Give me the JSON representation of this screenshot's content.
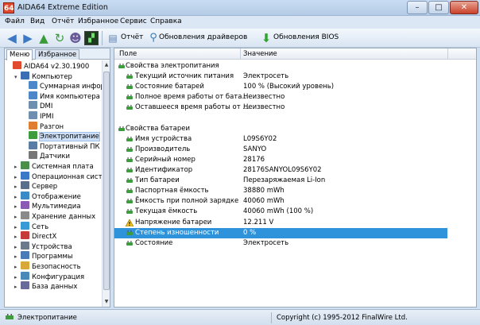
{
  "window": {
    "title": "AIDA64 Extreme Edition",
    "app_icon_text": "64",
    "min": "–",
    "max": "□",
    "close": "✕"
  },
  "menu": [
    "Файл",
    "Вид",
    "Отчёт",
    "Избранное",
    "Сервис",
    "Справка"
  ],
  "toolbar": {
    "report": "Отчёт",
    "driver_updates": "Обновления драйверов",
    "bios_updates": "Обновления BIOS"
  },
  "left": {
    "tabs": [
      "Меню",
      "Избранное"
    ],
    "tree": [
      {
        "label": "AIDA64 v2.30.1900",
        "level": 0,
        "exp": "",
        "icon": "#e04a2f"
      },
      {
        "label": "Компьютер",
        "level": 1,
        "exp": "▾",
        "icon": "#3a6fb5"
      },
      {
        "label": "Суммарная инфор",
        "level": 2,
        "exp": "",
        "icon": "#4b87c9"
      },
      {
        "label": "Имя компьютера",
        "level": 2,
        "exp": "",
        "icon": "#4b87c9"
      },
      {
        "label": "DMI",
        "level": 2,
        "exp": "",
        "icon": "#6f8fb0"
      },
      {
        "label": "IPMI",
        "level": 2,
        "exp": "",
        "icon": "#6f8fb0"
      },
      {
        "label": "Разгон",
        "level": 2,
        "exp": "",
        "icon": "#e07d2f"
      },
      {
        "label": "Электропитание",
        "level": 2,
        "exp": "",
        "icon": "#3e9b3e"
      },
      {
        "label": "Портативный ПК",
        "level": 2,
        "exp": "",
        "icon": "#5a7da6"
      },
      {
        "label": "Датчики",
        "level": 2,
        "exp": "",
        "icon": "#777777"
      },
      {
        "label": "Системная плата",
        "level": 1,
        "exp": "▸",
        "icon": "#4a8f4a"
      },
      {
        "label": "Операционная систем",
        "level": 1,
        "exp": "▸",
        "icon": "#3a78c8"
      },
      {
        "label": "Сервер",
        "level": 1,
        "exp": "▸",
        "icon": "#5a6f8a"
      },
      {
        "label": "Отображение",
        "level": 1,
        "exp": "▸",
        "icon": "#3a8ac8"
      },
      {
        "label": "Мультимедиа",
        "level": 1,
        "exp": "▸",
        "icon": "#8a5ab5"
      },
      {
        "label": "Хранение данных",
        "level": 1,
        "exp": "▸",
        "icon": "#8a8a8a"
      },
      {
        "label": "Сеть",
        "level": 1,
        "exp": "▸",
        "icon": "#3a9ad8"
      },
      {
        "label": "DirectX",
        "level": 1,
        "exp": "▸",
        "icon": "#c83a3a"
      },
      {
        "label": "Устройства",
        "level": 1,
        "exp": "▸",
        "icon": "#6a7a8a"
      },
      {
        "label": "Программы",
        "level": 1,
        "exp": "▸",
        "icon": "#4a7ab8"
      },
      {
        "label": "Безопасность",
        "level": 1,
        "exp": "▸",
        "icon": "#d8a83a"
      },
      {
        "label": "Конфигурация",
        "level": 1,
        "exp": "▸",
        "icon": "#4a8ab8"
      },
      {
        "label": "База данных",
        "level": 1,
        "exp": "▸",
        "icon": "#6a6a9a"
      }
    ],
    "selected_index": 7
  },
  "right": {
    "col_field": "Поле",
    "col_value": "Значение",
    "rows": [
      {
        "type": "section",
        "field": "Свойства электропитания",
        "value": ""
      },
      {
        "type": "item",
        "field": "Текущий источник питания",
        "value": "Электросеть"
      },
      {
        "type": "item",
        "field": "Состояние батарей",
        "value": "100 % (Высокий уровень)"
      },
      {
        "type": "item",
        "field": "Полное время работы от бата...",
        "value": "Неизвестно"
      },
      {
        "type": "item",
        "field": "Оставшееся время работы от ...",
        "value": "Неизвестно"
      },
      {
        "type": "blank",
        "field": "",
        "value": ""
      },
      {
        "type": "section",
        "field": "Свойства батареи",
        "value": ""
      },
      {
        "type": "item",
        "field": "Имя устройства",
        "value": "L09S6Y02"
      },
      {
        "type": "item",
        "field": "Производитель",
        "value": "SANYO"
      },
      {
        "type": "item",
        "field": "Серийный номер",
        "value": "28176"
      },
      {
        "type": "item",
        "field": "Идентификатор",
        "value": "28176SANYOL09S6Y02"
      },
      {
        "type": "item",
        "field": "Тип батареи",
        "value": "Перезаряжаемая Li-Ion"
      },
      {
        "type": "item",
        "field": "Паспортная ёмкость",
        "value": "38880 mWh"
      },
      {
        "type": "item",
        "field": "Ёмкость при полной зарядке",
        "value": "40060 mWh"
      },
      {
        "type": "item",
        "field": "Текущая ёмкость",
        "value": "40060 mWh  (100 %)"
      },
      {
        "type": "warn",
        "field": "Напряжение батареи",
        "value": "12.211 V"
      },
      {
        "type": "highlight",
        "field": "Степень изношенности",
        "value": "0 %"
      },
      {
        "type": "item",
        "field": "Состояние",
        "value": "Электросеть"
      }
    ]
  },
  "status": {
    "left": "Электропитание",
    "right": "Copyright (c) 1995-2012 FinalWire Ltd."
  },
  "colors": {
    "accent": "#2f93dc",
    "selection": "#cde0f7"
  }
}
